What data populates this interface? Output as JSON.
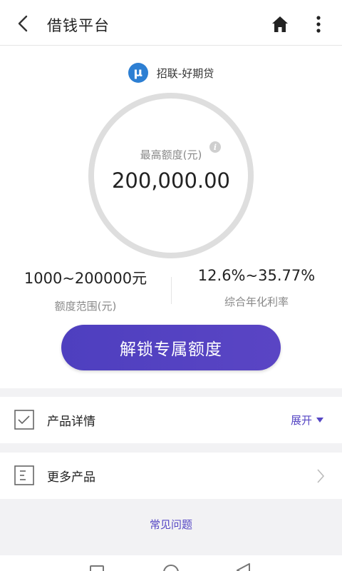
{
  "header": {
    "title": "借钱平台",
    "icons": {
      "back": "chevron-left-icon",
      "home": "home-icon",
      "more": "vertical-dots-icon"
    }
  },
  "product": {
    "logo_text": "µ",
    "logo_color": "#2d7fd3",
    "name": "招联-好期贷",
    "max_label": "最高额度(元)",
    "info_icon": "i",
    "max_amount": "200,000.00",
    "range_value": "1000~200000元",
    "range_label": "额度范围(元)",
    "rate_value": "12.6%~35.77%",
    "rate_label": "综合年化利率",
    "cta_label": "解锁专属额度",
    "accent_color": "#5546c4"
  },
  "sections": {
    "details": {
      "label": "产品详情",
      "action": "展开"
    },
    "more": {
      "label": "更多产品"
    }
  },
  "faq": {
    "label": "常见问题"
  }
}
